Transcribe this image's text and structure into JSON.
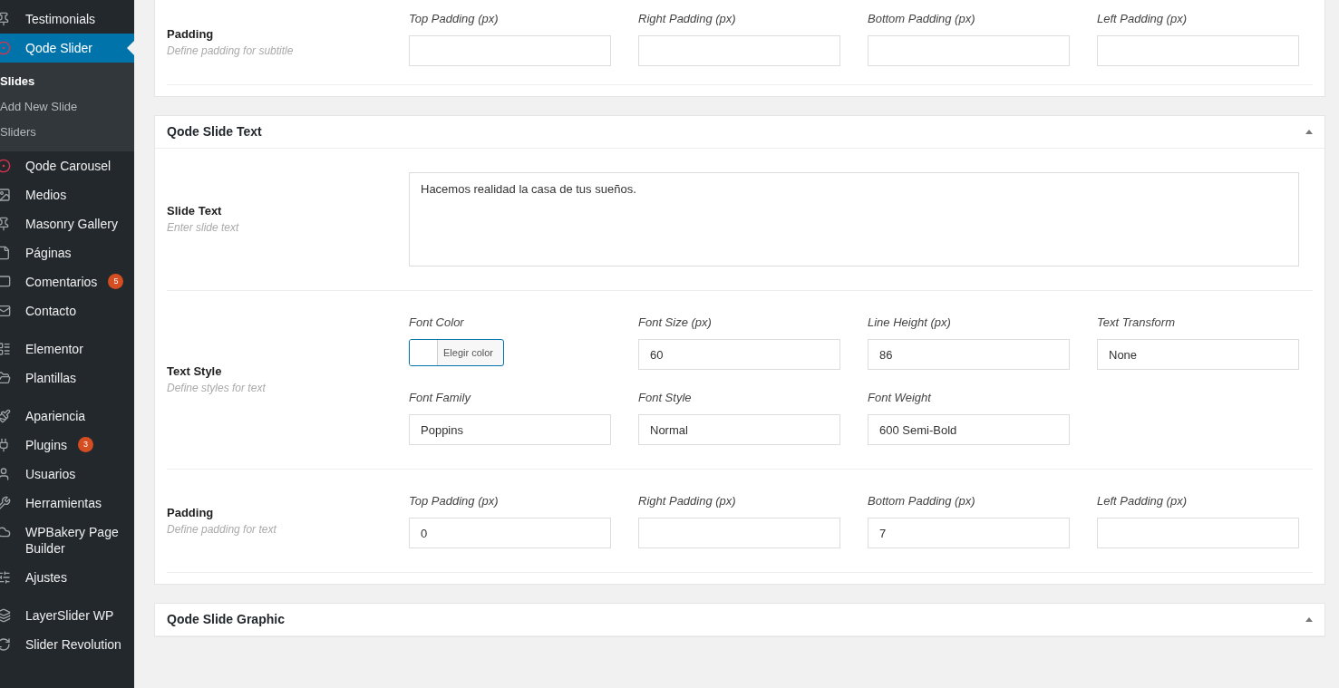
{
  "sidebar": {
    "sections": [
      {
        "items": [
          {
            "label": "Testimonials",
            "selected": false
          },
          {
            "label": "Qode Slider",
            "selected": true,
            "submenu": [
              {
                "label": "Slides",
                "selected": true
              },
              {
                "label": "Add New Slide",
                "selected": false
              },
              {
                "label": "Sliders",
                "selected": false
              }
            ]
          },
          {
            "label": "Qode Carousel",
            "selected": false
          },
          {
            "label": "Medios",
            "selected": false
          },
          {
            "label": "Masonry Gallery",
            "selected": false
          },
          {
            "label": "Páginas",
            "selected": false
          },
          {
            "label": "Comentarios",
            "selected": false,
            "badge": "5"
          },
          {
            "label": "Contacto",
            "selected": false
          }
        ]
      },
      {
        "items": [
          {
            "label": "Elementor",
            "selected": false
          },
          {
            "label": "Plantillas",
            "selected": false
          }
        ]
      },
      {
        "items": [
          {
            "label": "Apariencia",
            "selected": false
          },
          {
            "label": "Plugins",
            "selected": false,
            "badge": "3"
          },
          {
            "label": "Usuarios",
            "selected": false
          },
          {
            "label": "Herramientas",
            "selected": false
          },
          {
            "label": "WPBakery Page Builder",
            "selected": false
          },
          {
            "label": "Ajustes",
            "selected": false
          }
        ]
      },
      {
        "items": [
          {
            "label": "LayerSlider WP",
            "selected": false
          },
          {
            "label": "Slider Revolution",
            "selected": false
          }
        ]
      }
    ]
  },
  "panels": [
    {
      "rows": [
        {
          "kind": "fields",
          "label": "Padding",
          "hint": "Define padding for subtitle",
          "groups": [
            [
              {
                "kind": "text",
                "label": "Top Padding (px)"
              },
              {
                "kind": "text",
                "label": "Right Padding (px)"
              },
              {
                "kind": "text",
                "label": "Bottom Padding (px)"
              },
              {
                "kind": "text",
                "label": "Left Padding (px)"
              }
            ]
          ]
        }
      ]
    },
    {
      "title": "Qode Slide Text",
      "expanded": true,
      "rows": [
        {
          "kind": "textarea",
          "label": "Slide Text",
          "hint": "Enter slide text",
          "value": "Hacemos realidad la casa de tus sueños."
        },
        {
          "kind": "fields",
          "label": "Text Style",
          "hint": "Define styles for text",
          "groups": [
            [
              {
                "kind": "color",
                "label": "Font Color",
                "button": "Elegir color"
              },
              {
                "kind": "text",
                "label": "Font Size (px)",
                "value": "60"
              },
              {
                "kind": "text",
                "label": "Line Height (px)",
                "value": "86"
              },
              {
                "kind": "text",
                "label": "Text Transform",
                "value": "None"
              }
            ],
            [
              {
                "kind": "text",
                "label": "Font Family",
                "value": "Poppins"
              },
              {
                "kind": "text",
                "label": "Font Style",
                "value": "Normal"
              },
              {
                "kind": "text",
                "label": "Font Weight",
                "value": "600 Semi-Bold"
              }
            ]
          ]
        },
        {
          "kind": "fields",
          "label": "Padding",
          "hint": "Define padding for text",
          "groups": [
            [
              {
                "kind": "text",
                "label": "Top Padding (px)",
                "value": "0"
              },
              {
                "kind": "text",
                "label": "Right Padding (px)"
              },
              {
                "kind": "text",
                "label": "Bottom Padding (px)",
                "value": "7"
              },
              {
                "kind": "text",
                "label": "Left Padding (px)"
              }
            ]
          ]
        }
      ]
    },
    {
      "title": "Qode Slide Graphic",
      "expanded": true
    }
  ]
}
